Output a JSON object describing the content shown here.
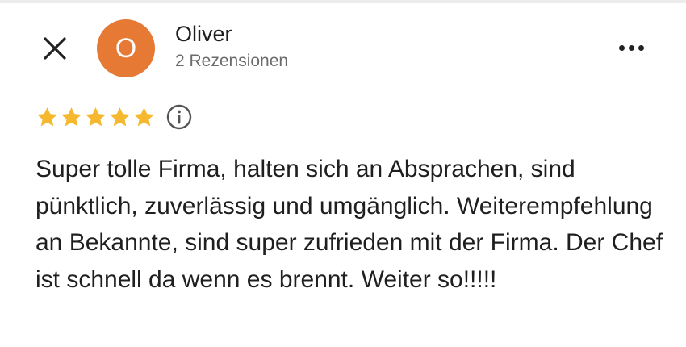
{
  "header": {
    "close_icon": "close-icon",
    "more_icon": "more-horizontal-icon"
  },
  "author": {
    "initial": "O",
    "avatar_color": "#e67a35",
    "name": "Oliver",
    "review_count": "2 Rezensionen"
  },
  "rating": {
    "stars": 5,
    "max_stars": 5,
    "star_color": "#f5b82e",
    "info_icon": "info-icon"
  },
  "review": {
    "text": "Super tolle Firma, halten sich an Absprachen, sind pünktlich, zuverlässig und umgänglich. Weiterempfehlung an Bekannte, sind super zufrieden mit der Firma. Der Chef ist schnell da wenn es brennt. Weiter so!!!!!"
  }
}
